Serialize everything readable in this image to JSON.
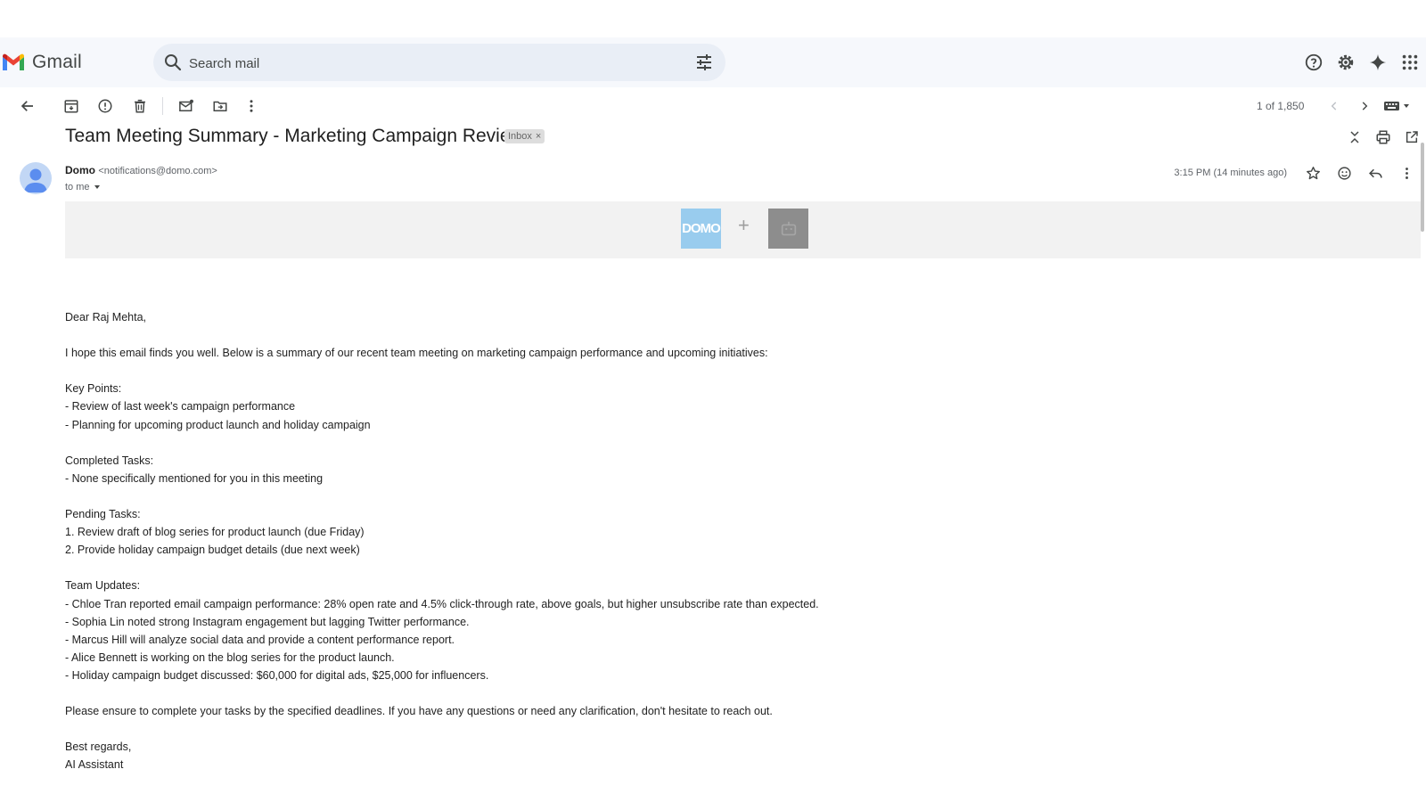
{
  "app": {
    "name": "Gmail"
  },
  "search": {
    "placeholder": "Search mail"
  },
  "pagination": {
    "counter": "1 of 1,850"
  },
  "message": {
    "subject": "Team Meeting Summary - Marketing Campaign Review",
    "label": "Inbox",
    "label_close": "×",
    "sender_name": "Domo",
    "sender_email": "<notifications@domo.com>",
    "recipient": "to me",
    "time": "3:15 PM (14 minutes ago)",
    "banner": {
      "logo_text": "DOMO",
      "plus": "+"
    },
    "body": [
      "Dear Raj Mehta,",
      "",
      "I hope this email finds you well. Below is a summary of our recent team meeting on marketing campaign performance and upcoming initiatives:",
      "",
      "Key Points:",
      "- Review of last week's campaign performance",
      "- Planning for upcoming product launch and holiday campaign",
      "",
      "Completed Tasks:",
      "- None specifically mentioned for you in this meeting",
      "",
      "Pending Tasks:",
      "1. Review draft of blog series for product launch (due Friday)",
      "2. Provide holiday campaign budget details (due next week)",
      "",
      "Team Updates:",
      "- Chloe Tran reported email campaign performance: 28% open rate and 4.5% click-through rate, above goals, but higher unsubscribe rate than expected.",
      "- Sophia Lin noted strong Instagram engagement but lagging Twitter performance.",
      "- Marcus Hill will analyze social data and provide a content performance report.",
      "- Alice Bennett is working on the blog series for the product launch.",
      "- Holiday campaign budget discussed: $60,000 for digital ads, $25,000 for influencers.",
      "",
      "Please ensure to complete your tasks by the specified deadlines. If you have any questions or need any clarification, don't hesitate to reach out.",
      "",
      "Best regards,",
      "AI Assistant"
    ]
  },
  "colors": {
    "app_bg": "#f6f8fc",
    "search_bg": "#e9eef6",
    "domo_blue": "#99ccee",
    "gmail_red": "#ea4335",
    "gmail_blue": "#4285f4",
    "gmail_green": "#34a853",
    "gmail_yellow": "#fbbc04"
  },
  "icons": {
    "header": [
      "help-icon",
      "settings-icon",
      "gemini-icon",
      "apps-icon"
    ],
    "toolbar": [
      "back-arrow-icon",
      "archive-icon",
      "report-spam-icon",
      "delete-icon",
      "mark-unread-icon",
      "move-to-icon",
      "more-vert-icon",
      "prev-icon",
      "next-icon",
      "input-tools-icon"
    ],
    "message": [
      "collapse-icon",
      "print-icon",
      "open-new-window-icon",
      "star-icon",
      "emoji-icon",
      "reply-icon",
      "more-vert-icon"
    ]
  }
}
